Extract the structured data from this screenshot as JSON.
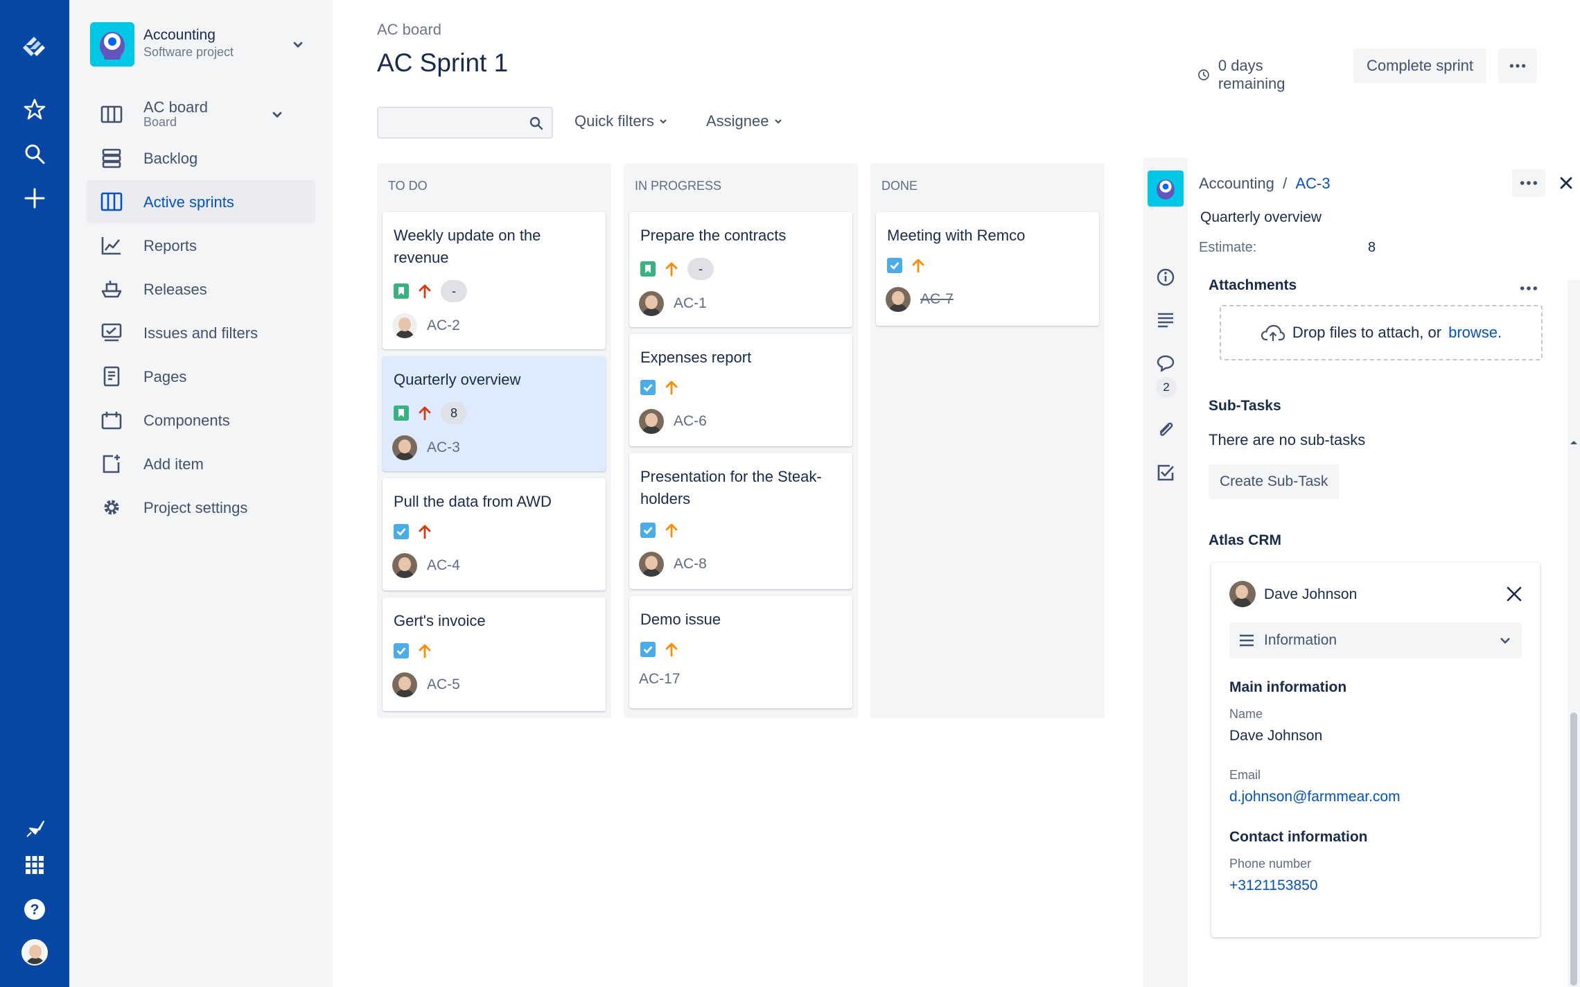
{
  "colors": {
    "global_nav": "#0747a6",
    "sidebar": "#f4f5f7",
    "accent": "#0052cc",
    "selected_card": "#deebff",
    "story": "#36b37e",
    "task": "#4bade8",
    "priority_high": "#de350b",
    "priority_medium": "#ff8b00"
  },
  "global_nav": {
    "icons": [
      "jira-logo-icon",
      "star-icon",
      "search-icon",
      "plus-icon",
      "feedback-icon",
      "app-switcher-icon",
      "help-icon",
      "profile-avatar"
    ]
  },
  "project": {
    "name": "Accounting",
    "type": "Software project"
  },
  "board_switch": {
    "name": "AC board",
    "type": "Board"
  },
  "nav": [
    {
      "label": "Backlog",
      "icon": "backlog-icon"
    },
    {
      "label": "Active sprints",
      "icon": "board-columns-icon"
    },
    {
      "label": "Reports",
      "icon": "chart-icon"
    },
    {
      "label": "Releases",
      "icon": "ship-icon"
    },
    {
      "label": "Issues and filters",
      "icon": "issues-icon"
    },
    {
      "label": "Pages",
      "icon": "page-icon"
    },
    {
      "label": "Components",
      "icon": "component-icon"
    },
    {
      "label": "Add item",
      "icon": "add-item-icon"
    },
    {
      "label": "Project settings",
      "icon": "gear-icon"
    }
  ],
  "header": {
    "breadcrumb": "AC board",
    "title": "AC Sprint 1",
    "days_remaining": "0 days remaining",
    "complete_sprint": "Complete sprint"
  },
  "toolbar": {
    "search_value": "",
    "quick_filters": "Quick filters",
    "assignee": "Assignee"
  },
  "columns": [
    {
      "title": "TO DO",
      "cards": [
        {
          "title": "Weekly update on the revenue",
          "type": "story",
          "priority": "high",
          "estimate": "-",
          "key": "AC-2"
        },
        {
          "title": "Quarterly overview",
          "type": "story",
          "priority": "high",
          "estimate": "8",
          "key": "AC-3",
          "selected": true
        },
        {
          "title": "Pull the data from AWD",
          "type": "task",
          "priority": "high",
          "key": "AC-4"
        },
        {
          "title": "Gert's invoice",
          "type": "task",
          "priority": "medium",
          "key": "AC-5"
        }
      ]
    },
    {
      "title": "IN PROGRESS",
      "cards": [
        {
          "title": "Prepare the contracts",
          "type": "story",
          "priority": "medium",
          "estimate": "-",
          "key": "AC-1"
        },
        {
          "title": "Expenses report",
          "type": "task",
          "priority": "medium",
          "key": "AC-6"
        },
        {
          "title": "Presentation for the Steak-holders",
          "type": "task",
          "priority": "medium",
          "key": "AC-8"
        },
        {
          "title": "Demo issue",
          "type": "task",
          "priority": "medium",
          "key": "AC-17"
        }
      ]
    },
    {
      "title": "DONE",
      "cards": [
        {
          "title": "Meeting with Remco",
          "type": "task",
          "priority": "medium",
          "key": "AC-7",
          "done": true
        }
      ]
    }
  ],
  "detail": {
    "project": "Accounting",
    "separator": "/",
    "key": "AC-3",
    "summary": "Quarterly overview",
    "estimate_label": "Estimate:",
    "estimate_value": "8",
    "comment_count": "2",
    "attachments_title": "Attachments",
    "drop_text": "Drop files to attach, or",
    "browse": "browse.",
    "subtasks_title": "Sub-Tasks",
    "no_subtasks": "There are no sub-tasks",
    "create_subtask": "Create Sub-Task",
    "crm_title": "Atlas CRM",
    "crm": {
      "contact": "Dave Johnson",
      "view": "Information",
      "main_info": "Main information",
      "name_label": "Name",
      "name_value": "Dave Johnson",
      "email_label": "Email",
      "email_value": "d.johnson@farmmear.com",
      "contact_info": "Contact information",
      "phone_label": "Phone number",
      "phone_value": "+3121153850"
    }
  }
}
